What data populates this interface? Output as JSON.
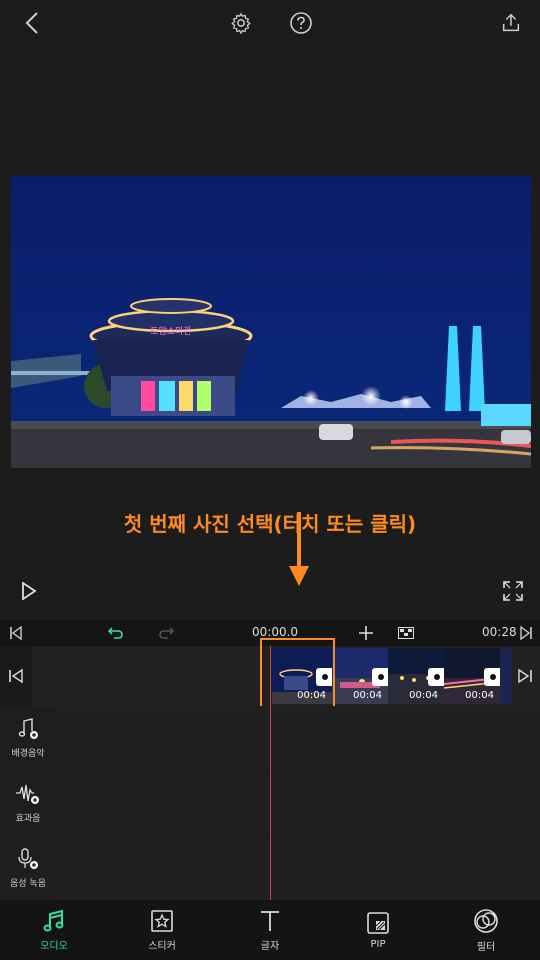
{
  "toolbar": {
    "back_icon": "chevron-left-icon",
    "settings_icon": "gear-icon",
    "help_icon": "question-circle-icon",
    "export_icon": "share-upload-icon"
  },
  "preview": {
    "instruction": "첫 번째 사진 선택(터치 또는 클릭)",
    "sign_text": "토망소마관",
    "play_icon": "play-icon",
    "fullscreen_icon": "fullscreen-icon"
  },
  "timeline": {
    "current_time": "00:00.0",
    "total_time": "00:28",
    "clips": [
      {
        "duration": "00:04"
      },
      {
        "duration": "00:04"
      },
      {
        "duration": "00:04"
      },
      {
        "duration": "00:04"
      }
    ]
  },
  "tracks": [
    {
      "label": "배경음악",
      "icon": "music-note-add-icon"
    },
    {
      "label": "효과음",
      "icon": "waveform-add-icon"
    },
    {
      "label": "음성 녹음",
      "icon": "microphone-add-icon"
    }
  ],
  "bottom_nav": [
    {
      "label": "오디오",
      "icon": "music-icon",
      "active": true
    },
    {
      "label": "스티커",
      "icon": "sticker-star-icon",
      "active": false
    },
    {
      "label": "글자",
      "icon": "text-t-icon",
      "active": false
    },
    {
      "label": "PIP",
      "icon": "pip-icon",
      "active": false
    },
    {
      "label": "필터",
      "icon": "filter-icon",
      "active": false
    }
  ],
  "colors": {
    "accent": "#2fe0a8",
    "highlight": "#ff8a1d",
    "playhead": "#d83a5a"
  }
}
